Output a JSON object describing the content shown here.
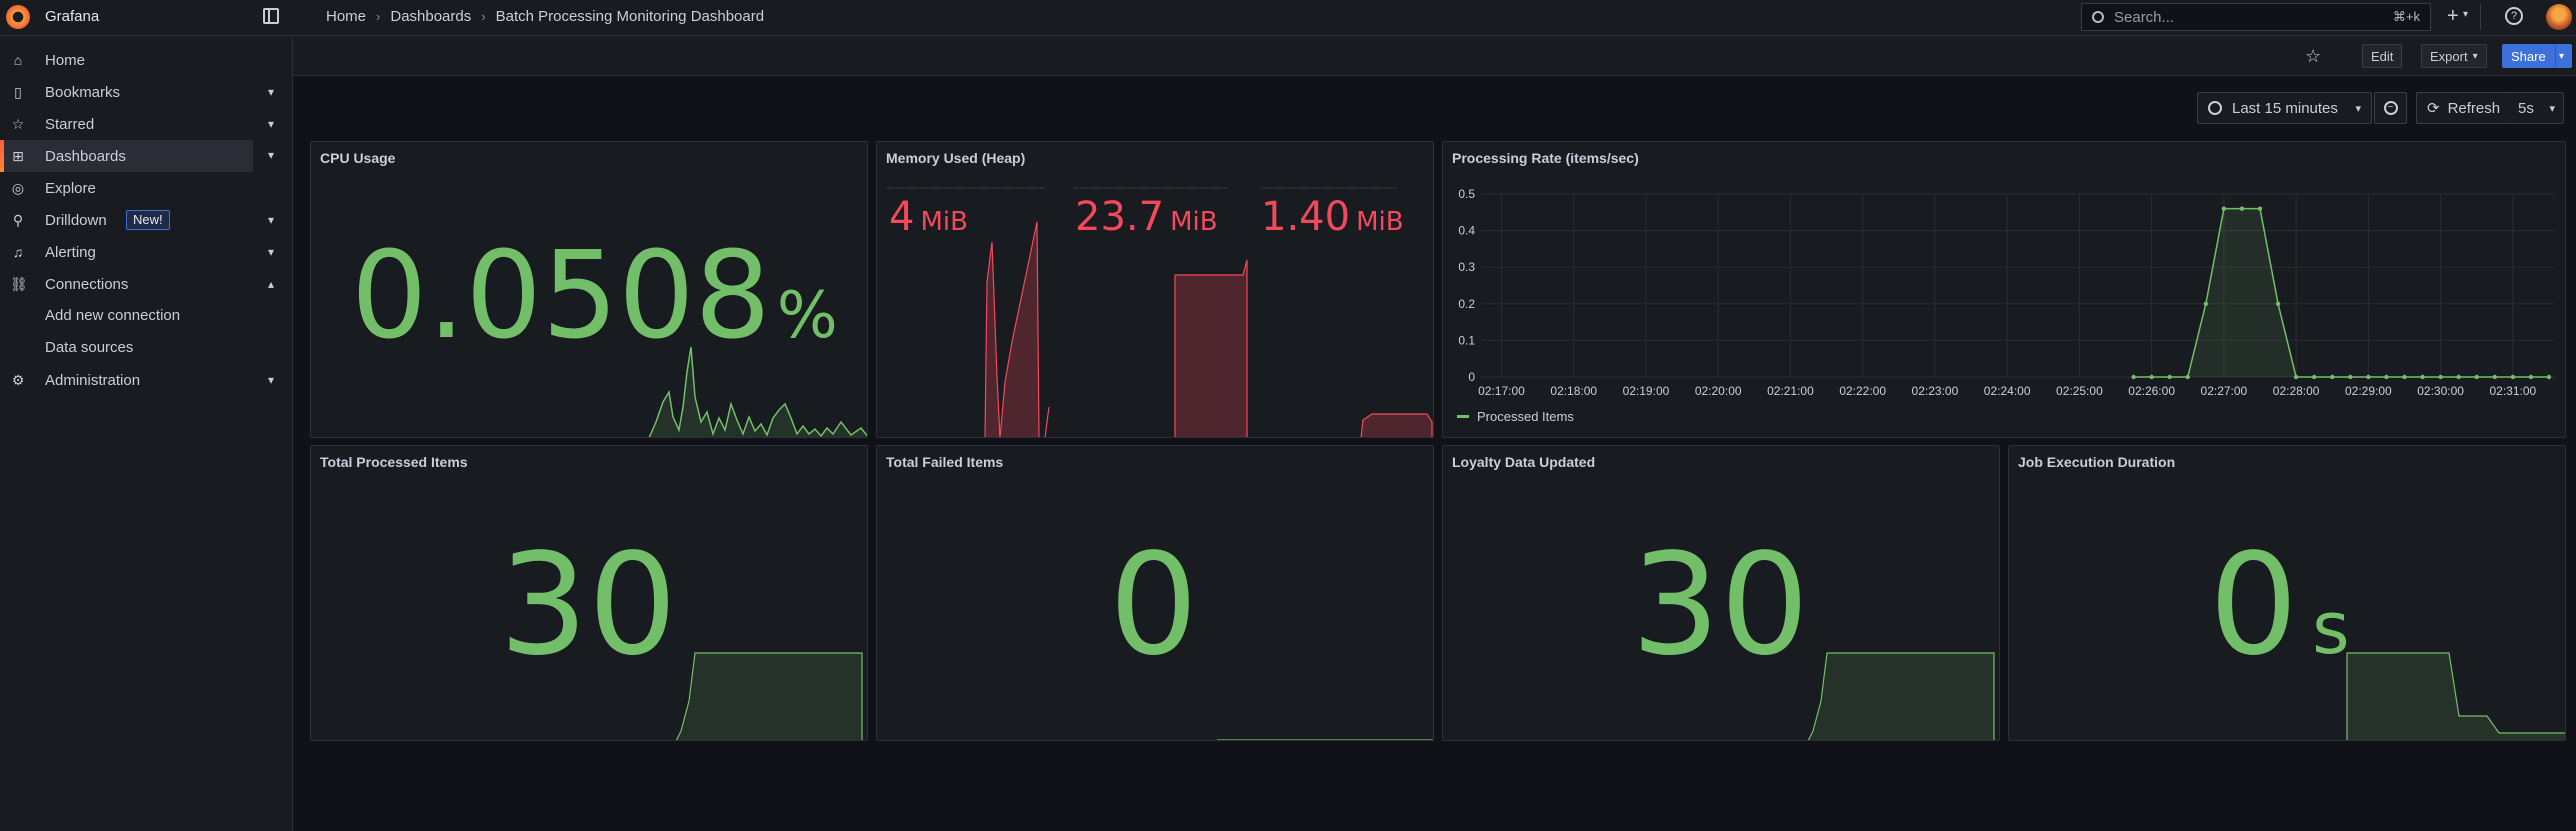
{
  "topbar": {
    "brand": "Grafana",
    "breadcrumbs": [
      "Home",
      "Dashboards",
      "Batch Processing Monitoring Dashboard"
    ],
    "search_placeholder": "Search...",
    "search_shortcut": "⌘+k",
    "plus_label": "+"
  },
  "sidebar": {
    "items": [
      {
        "label": "Home",
        "icon": "home-icon",
        "chevron": false
      },
      {
        "label": "Bookmarks",
        "icon": "bookmark-icon",
        "chevron": true
      },
      {
        "label": "Starred",
        "icon": "star-icon",
        "chevron": true
      },
      {
        "label": "Dashboards",
        "icon": "apps-icon",
        "chevron": true,
        "active": true
      },
      {
        "label": "Explore",
        "icon": "compass-icon",
        "chevron": false
      },
      {
        "label": "Drilldown",
        "icon": "microscope-icon",
        "chevron": true,
        "badge": "New!"
      },
      {
        "label": "Alerting",
        "icon": "bell-icon",
        "chevron": true
      },
      {
        "label": "Connections",
        "icon": "link-icon",
        "chevron": true,
        "expanded": true
      },
      {
        "label": "Add new connection",
        "sub": true
      },
      {
        "label": "Data sources",
        "sub": true
      },
      {
        "label": "Administration",
        "icon": "cog-icon",
        "chevron": true
      }
    ]
  },
  "toolbar": {
    "edit": "Edit",
    "export": "Export",
    "share": "Share",
    "time_range": "Last 15 minutes",
    "refresh": "Refresh",
    "refresh_interval": "5s"
  },
  "panels": {
    "cpu": {
      "title": "CPU Usage",
      "value": "0.0508",
      "unit": "%"
    },
    "memory": {
      "title": "Memory Used (Heap)",
      "values": [
        {
          "value": "4",
          "unit": "MiB"
        },
        {
          "value": "23.7",
          "unit": "MiB"
        },
        {
          "value": "1.40",
          "unit": "MiB"
        }
      ]
    },
    "rate": {
      "title": "Processing Rate (items/sec)",
      "legend": "Processed Items"
    },
    "total": {
      "title": "Total Processed Items",
      "value": "30"
    },
    "failed": {
      "title": "Total Failed Items",
      "value": "0"
    },
    "loyalty": {
      "title": "Loyalty Data Updated",
      "value": "30"
    },
    "duration": {
      "title": "Job Execution Duration",
      "value": "0",
      "unit": "s"
    }
  },
  "colors": {
    "green": "#73bf69",
    "red": "#f2495c",
    "accent": "#3d71d9"
  },
  "chart_data": {
    "type": "line",
    "title": "Processing Rate (items/sec)",
    "xlabel": "",
    "ylabel": "",
    "ylim": [
      0,
      0.5
    ],
    "y_ticks": [
      "0",
      "0.1",
      "0.2",
      "0.3",
      "0.4",
      "0.5"
    ],
    "x_ticks": [
      "02:17:00",
      "02:18:00",
      "02:19:00",
      "02:20:00",
      "02:21:00",
      "02:22:00",
      "02:23:00",
      "02:24:00",
      "02:25:00",
      "02:26:00",
      "02:27:00",
      "02:28:00",
      "02:29:00",
      "02:30:00",
      "02:31:00"
    ],
    "series": [
      {
        "name": "Processed Items",
        "x": [
          "02:25:45",
          "02:26:00",
          "02:26:15",
          "02:26:30",
          "02:26:45",
          "02:27:00",
          "02:27:15",
          "02:27:30",
          "02:27:45",
          "02:28:00",
          "02:28:15",
          "02:28:30",
          "02:28:45",
          "02:29:00",
          "02:29:15",
          "02:29:30",
          "02:29:45",
          "02:30:00",
          "02:30:15",
          "02:30:30",
          "02:30:45",
          "02:31:00",
          "02:31:15",
          "02:31:30"
        ],
        "values": [
          0,
          0,
          0,
          0,
          0.2,
          0.46,
          0.46,
          0.46,
          0.2,
          0,
          0,
          0,
          0,
          0,
          0,
          0,
          0,
          0,
          0,
          0,
          0,
          0,
          0,
          0
        ]
      }
    ]
  }
}
